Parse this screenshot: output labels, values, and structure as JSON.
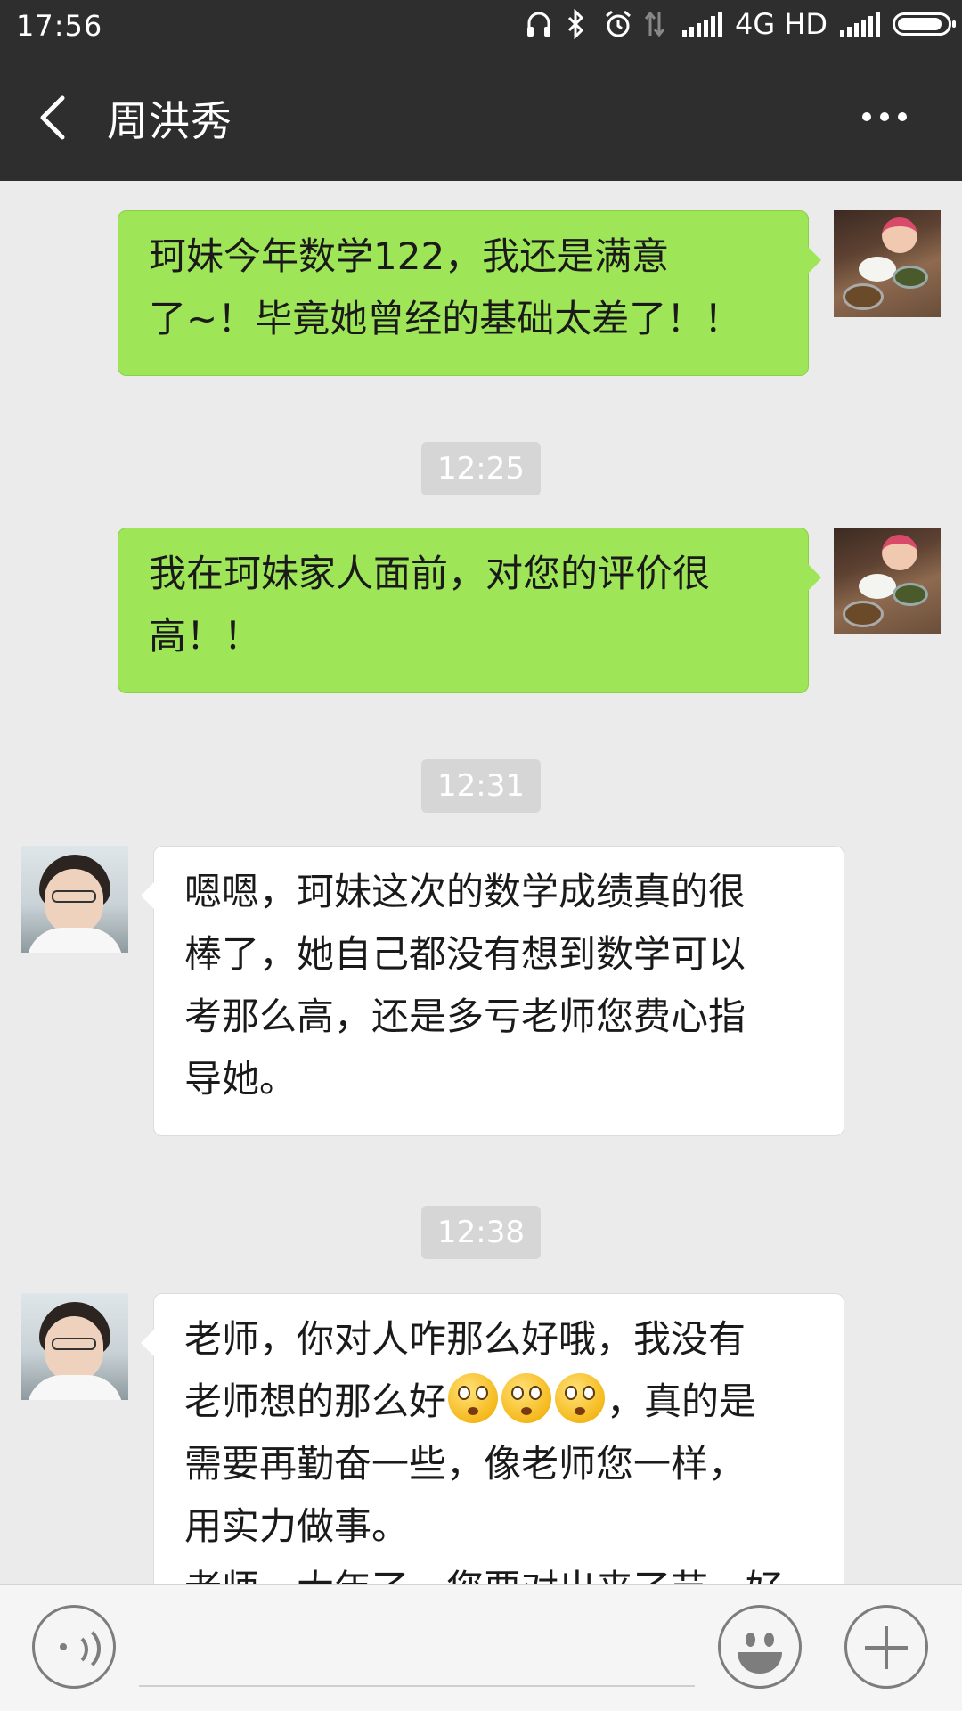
{
  "status_bar": {
    "time": "17:56",
    "network": "4G HD",
    "icons": [
      "headphones-icon",
      "bluetooth-icon",
      "alarm-icon",
      "data-transfer-icon",
      "signal-icon",
      "signal-icon",
      "battery-icon"
    ]
  },
  "header": {
    "back_icon": "chevron-left-icon",
    "title": "周洪秀",
    "more_icon": "more-dots-icon",
    "background": "#2e2e2e"
  },
  "messages": [
    {
      "sender": "self",
      "lines": [
        "珂妹今年数学122，我还是满意",
        "了~！毕竟她曾经的基础太差了！！"
      ]
    },
    {
      "timestamp": "12:25"
    },
    {
      "sender": "self",
      "lines": [
        "我在珂妹家人面前，对您的评价很",
        "高！！"
      ]
    },
    {
      "timestamp": "12:31"
    },
    {
      "sender": "other",
      "lines": [
        "嗯嗯，珂妹这次的数学成绩真的很",
        "棒了，她自己都没有想到数学可以",
        "考那么高，还是多亏老师您费心指",
        "导她。"
      ]
    },
    {
      "timestamp": "12:38"
    },
    {
      "sender": "other",
      "lines": [
        "老师，你对人咋那么好哦，我没有",
        "老师想的那么好",
        "，真的是",
        "需要再勤奋一些，像老师您一样，",
        "用实力做事。",
        "老师，大年了，您要对出来了节，好"
      ]
    }
  ],
  "colors": {
    "sent_bubble": "#9fe558",
    "received_bubble": "#ffffff",
    "chat_background": "#ebebeb",
    "timestamp_bg": "#d6d6d6"
  },
  "input_bar": {
    "voice_icon": "voice-input-icon",
    "emoji_icon": "emoji-icon",
    "plus_icon": "plus-icon"
  }
}
